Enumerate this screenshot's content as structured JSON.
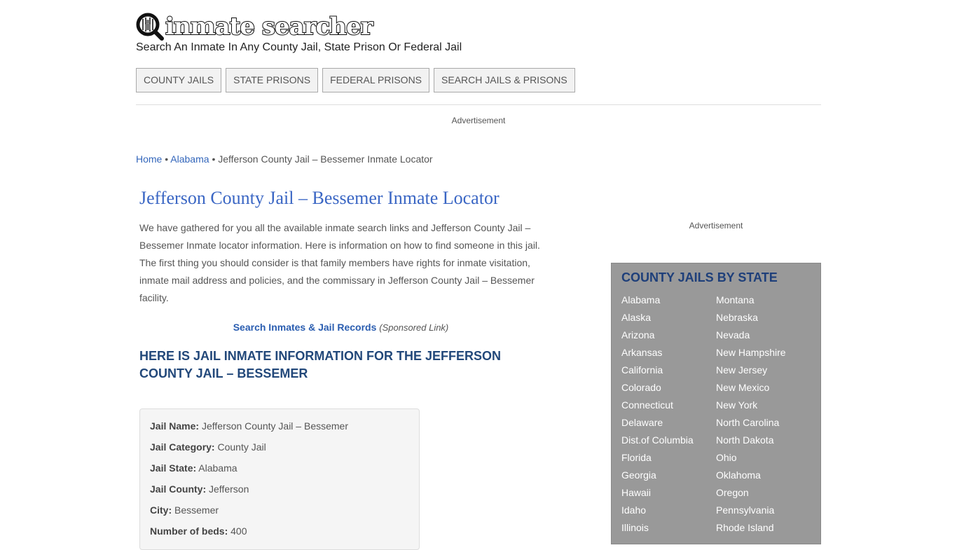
{
  "header": {
    "logo_text": "inmate searcher",
    "tagline": "Search An Inmate In Any County Jail, State Prison Or Federal Jail"
  },
  "nav": {
    "items": [
      {
        "label": "COUNTY JAILS"
      },
      {
        "label": "STATE PRISONS"
      },
      {
        "label": "FEDERAL PRISONS"
      },
      {
        "label": "SEARCH JAILS & PRISONS"
      }
    ]
  },
  "ads": {
    "top_label": "Advertisement",
    "side_label": "Advertisement"
  },
  "breadcrumb": {
    "home": "Home",
    "separator": "•",
    "state": "Alabama",
    "current": "Jefferson County Jail – Bessemer Inmate Locator"
  },
  "main": {
    "title": "Jefferson County Jail – Bessemer Inmate Locator",
    "intro": "We have gathered for you all the available inmate search links and Jefferson County Jail – Bessemer Inmate locator information. Here is information on how to find someone in this jail. The first thing you should consider is that family members have rights for inmate visitation, inmate mail address and policies, and the commissary in Jefferson County Jail – Bessemer facility.",
    "sponsored_link": "Search Inmates & Jail Records",
    "sponsored_note": "(Sponsored Link)",
    "section_heading": "Here is Jail Inmate Information for the Jefferson County Jail – Bessemer"
  },
  "info_box": {
    "rows": [
      {
        "label": "Jail Name:",
        "value": "Jefferson County Jail – Bessemer"
      },
      {
        "label": "Jail Category:",
        "value": "County Jail"
      },
      {
        "label": "Jail State:",
        "value": "Alabama"
      },
      {
        "label": "Jail County:",
        "value": "Jefferson"
      },
      {
        "label": "City:",
        "value": "Bessemer"
      },
      {
        "label": "Number of beds:",
        "value": "400"
      }
    ]
  },
  "sidebar": {
    "title": "COUNTY JAILS BY STATE",
    "col1": [
      "Alabama",
      "Alaska",
      "Arizona",
      "Arkansas",
      "California",
      "Colorado",
      "Connecticut",
      "Delaware",
      "Dist.of Columbia",
      "Florida",
      "Georgia",
      "Hawaii",
      "Idaho",
      "Illinois"
    ],
    "col2": [
      "Montana",
      "Nebraska",
      "Nevada",
      "New Hampshire",
      "New Jersey",
      "New Mexico",
      "New York",
      "North Carolina",
      "North Dakota",
      "Ohio",
      "Oklahoma",
      "Oregon",
      "Pennsylvania",
      "Rhode Island"
    ]
  }
}
